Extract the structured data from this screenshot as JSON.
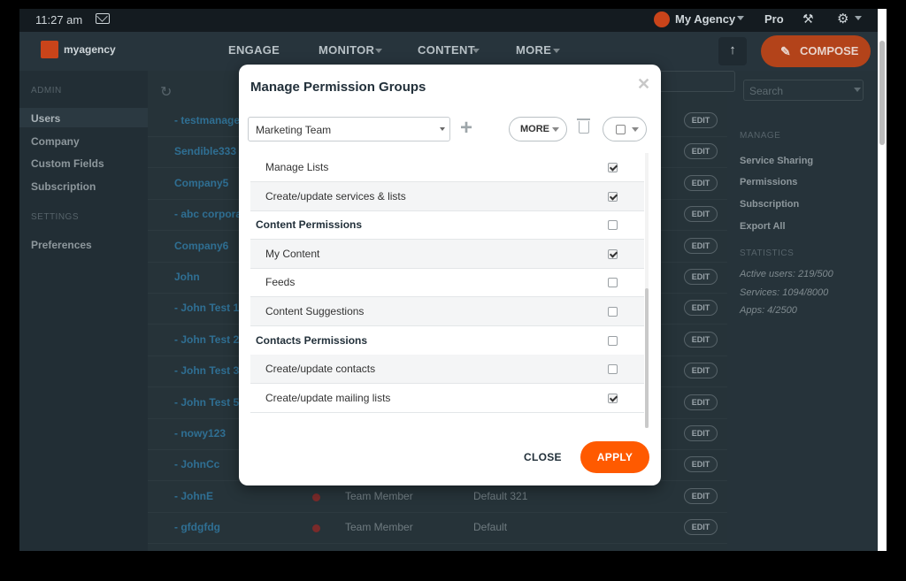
{
  "status_bar": {
    "time": "11:27 am",
    "agency": "My Agency",
    "plan": "Pro"
  },
  "nav": {
    "logo": "myagency",
    "items": [
      "ENGAGE",
      "MONITOR",
      "CONTENT",
      "MORE"
    ],
    "compose_label": "COMPOSE"
  },
  "sidebar": {
    "admin_section": "ADMIN",
    "admin_items": [
      "Users",
      "Company",
      "Custom Fields",
      "Subscription"
    ],
    "settings_section": "SETTINGS",
    "settings_items": [
      "Preferences"
    ]
  },
  "users": {
    "edit_label": "EDIT",
    "rows": [
      {
        "name": "- testmanage"
      },
      {
        "name": "Sendible333"
      },
      {
        "name": "Company5"
      },
      {
        "name": "- abc corpora"
      },
      {
        "name": "Company6"
      },
      {
        "name": "John"
      },
      {
        "name": "- John Test 1c"
      },
      {
        "name": "- John Test 2"
      },
      {
        "name": "- John Test 3"
      },
      {
        "name": "- John Test 5"
      },
      {
        "name": "- nowy123"
      },
      {
        "name": "- JohnCc"
      },
      {
        "name": "- JohnE",
        "role": "Team Member",
        "team": "Default 321"
      },
      {
        "name": "- gfdgfdg",
        "role": "Team Member",
        "team": "Default"
      }
    ]
  },
  "right_panel": {
    "search_placeholder": "Search",
    "manage_section": "MANAGE",
    "manage_items": [
      "Service Sharing",
      "Permissions",
      "Subscription",
      "Export All"
    ],
    "stats_section": "STATISTICS",
    "stats": [
      "Active users: 219/500",
      "Services: 1094/8000",
      "Apps: 4/2500"
    ]
  },
  "modal": {
    "title": "Manage Permission Groups",
    "group_select": "Marketing Team",
    "more_label": "MORE",
    "close_label": "CLOSE",
    "apply_label": "APPLY",
    "permissions": [
      {
        "label": "Manage Lists",
        "type": "sub",
        "checked": true
      },
      {
        "label": "Create/update services & lists",
        "type": "sub",
        "checked": true
      },
      {
        "label": "Content Permissions",
        "type": "head",
        "checked": false
      },
      {
        "label": "My Content",
        "type": "sub",
        "checked": true
      },
      {
        "label": "Feeds",
        "type": "sub",
        "checked": false
      },
      {
        "label": "Content Suggestions",
        "type": "sub",
        "checked": false
      },
      {
        "label": "Contacts Permissions",
        "type": "head",
        "checked": false
      },
      {
        "label": "Create/update contacts",
        "type": "sub",
        "checked": false
      },
      {
        "label": "Create/update mailing lists",
        "type": "sub",
        "checked": true
      }
    ]
  },
  "colors": {
    "accent": "#ff5a00",
    "link": "#2f6f93"
  }
}
